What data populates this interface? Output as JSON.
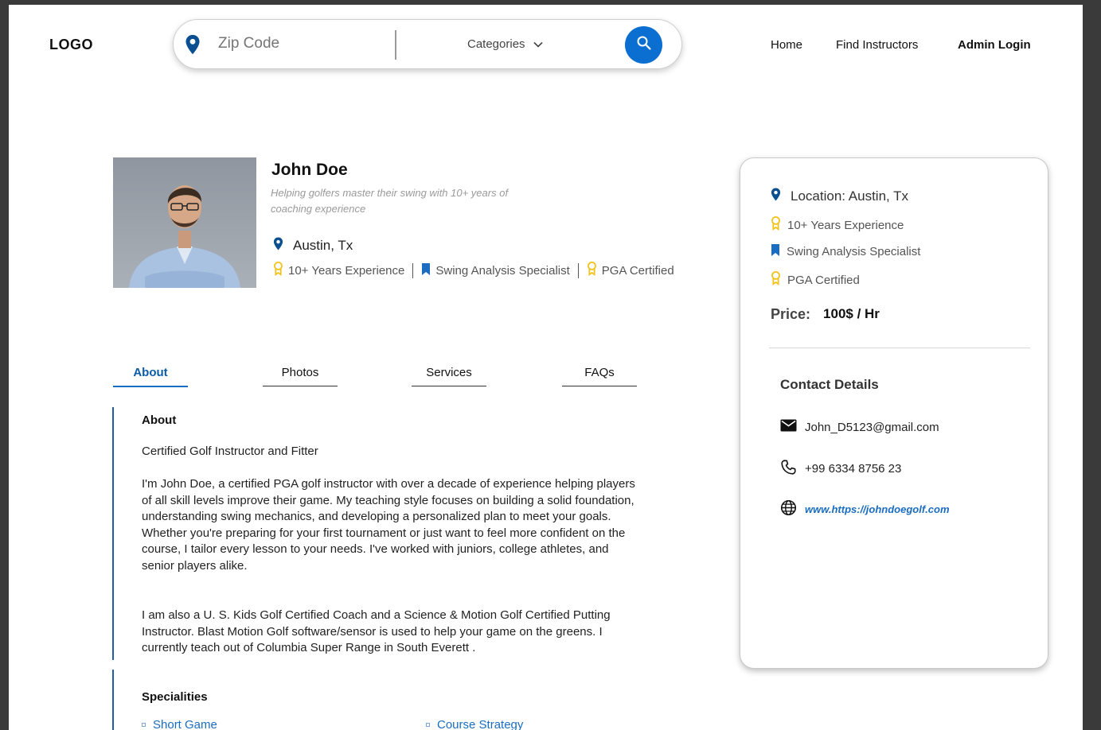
{
  "header": {
    "logo": "LOGO",
    "zip_placeholder": "Zip Code",
    "categories_label": "Categories",
    "nav": [
      "Home",
      "Find Instructors",
      "Admin Login"
    ]
  },
  "profile": {
    "name": "John Doe",
    "tagline": "Helping golfers master their swing with 10+ years of coaching experience",
    "location": "Austin, Tx",
    "badges": [
      "10+ Years Experience",
      "Swing Analysis Specialist",
      "PGA Certified"
    ]
  },
  "tabs": [
    "About",
    "Photos",
    "Services",
    "FAQs"
  ],
  "about": {
    "heading": "About",
    "subheading": "Certified Golf Instructor and Fitter",
    "para1": "I'm John Doe, a certified PGA golf instructor with over a decade of experience helping players of all skill levels improve their game. My teaching style focuses on building a solid foundation, understanding swing mechanics, and developing a personalized plan to meet your goals. Whether you're preparing for your first tournament or just want to feel more confident on the course, I tailor every lesson to your needs. I've worked with juniors, college athletes, and senior players alike.",
    "para2": "I am also a U. S. Kids Golf Certified Coach and a Science & Motion Golf Certified Putting Instructor. Blast Motion Golf software/sensor is used to help your game on the greens.  I currently teach out of Columbia Super Range in South Everett ."
  },
  "specialities": {
    "heading": "Specialities",
    "items": [
      "Short Game",
      "Course Strategy"
    ]
  },
  "card": {
    "location": "Location: Austin, Tx",
    "experience": "10+ Years Experience",
    "specialist": "Swing Analysis Specialist",
    "certification": "PGA Certified",
    "price_label": "Price:",
    "price_value": "100$ / Hr",
    "contact_heading": "Contact Details",
    "email": "John_D5123@gmail.com",
    "phone": "+99 6334 8756 23",
    "website": "www.https://johndoegolf.com"
  },
  "colors": {
    "accent": "#0a6fd0",
    "pin": "#0a4f8f",
    "award": "#f2c21b",
    "link": "#1a6dc0"
  }
}
